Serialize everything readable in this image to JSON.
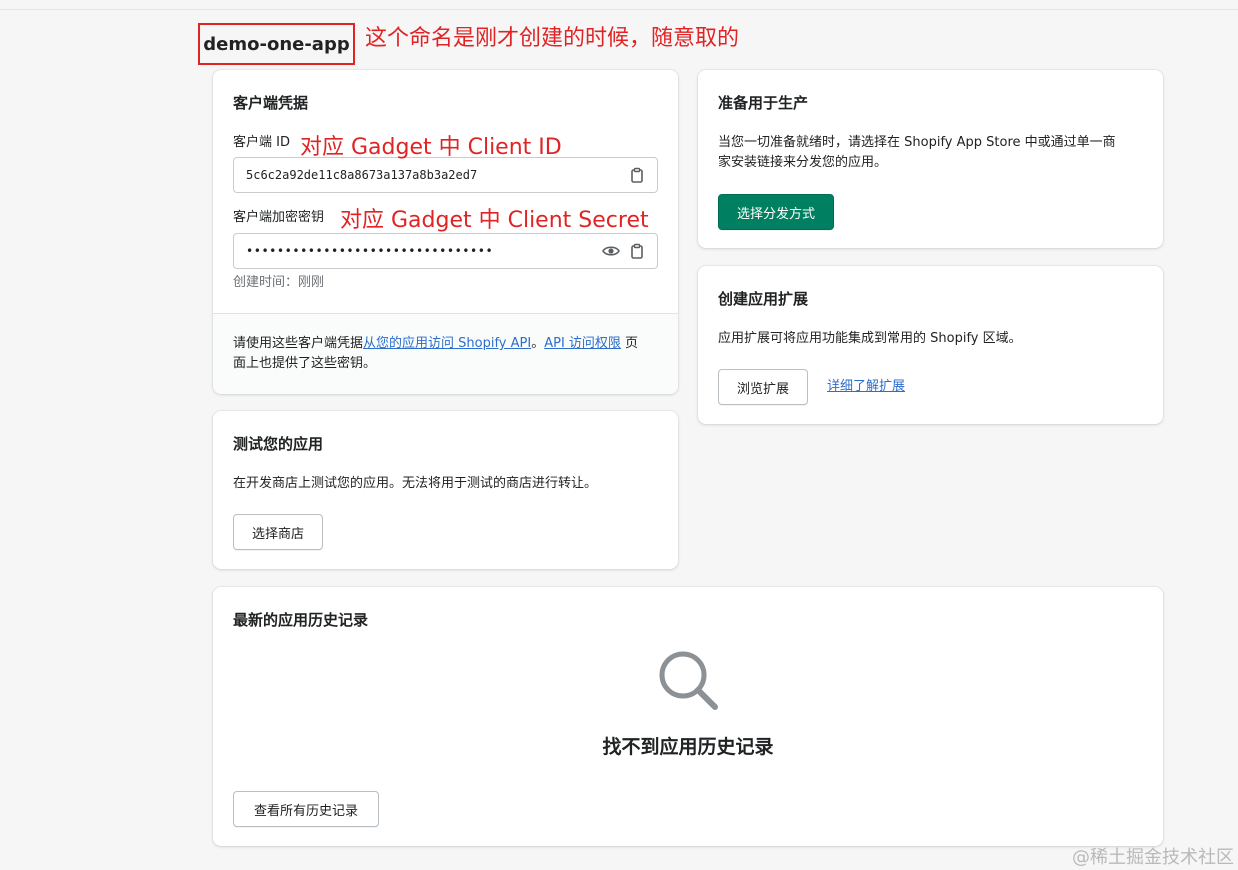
{
  "app": {
    "title": "demo-one-app"
  },
  "annotations": {
    "title_note": "这个命名是刚才创建的时候，随意取的",
    "client_id_note": "对应 Gadget 中 Client ID",
    "client_secret_note": "对应 Gadget 中 Client Secret"
  },
  "credentials": {
    "title": "客户端凭据",
    "client_id_label": "客户端 ID",
    "client_id_value": "5c6c2a92de11c8a8673a137a8b3a2ed7",
    "secret_label": "客户端加密密钥",
    "secret_value": "••••••••••••••••••••••••••••••••",
    "created_label": "创建时间：刚刚",
    "footer_prefix": "请使用这些客户端凭据",
    "footer_link1": "从您的应用访问 Shopify API",
    "footer_sep": "。",
    "footer_link2": "API 访问权限",
    "footer_suffix": " 页",
    "footer_line2": "面上也提供了这些密钥。"
  },
  "production": {
    "title": "准备用于生产",
    "desc_line1": "当您一切准备就绪时，请选择在 Shopify App Store 中或通过单一商",
    "desc_line2": "家安装链接来分发您的应用。",
    "button": "选择分发方式"
  },
  "extensions": {
    "title": "创建应用扩展",
    "desc": "应用扩展可将应用功能集成到常用的 Shopify 区域。",
    "button": "浏览扩展",
    "link": "详细了解扩展"
  },
  "test": {
    "title": "测试您的应用",
    "desc": "在开发商店上测试您的应用。无法将用于测试的商店进行转让。",
    "button": "选择商店"
  },
  "history": {
    "title": "最新的应用历史记录",
    "empty": "找不到应用历史记录",
    "button": "查看所有历史记录"
  },
  "icons": {
    "copy": "clipboard-icon",
    "eye": "eye-icon",
    "search": "search-icon"
  },
  "colors": {
    "primary": "#008060",
    "link": "#2c6ecb",
    "annotation": "#e02424"
  },
  "watermark": "@稀土掘金技术社区"
}
